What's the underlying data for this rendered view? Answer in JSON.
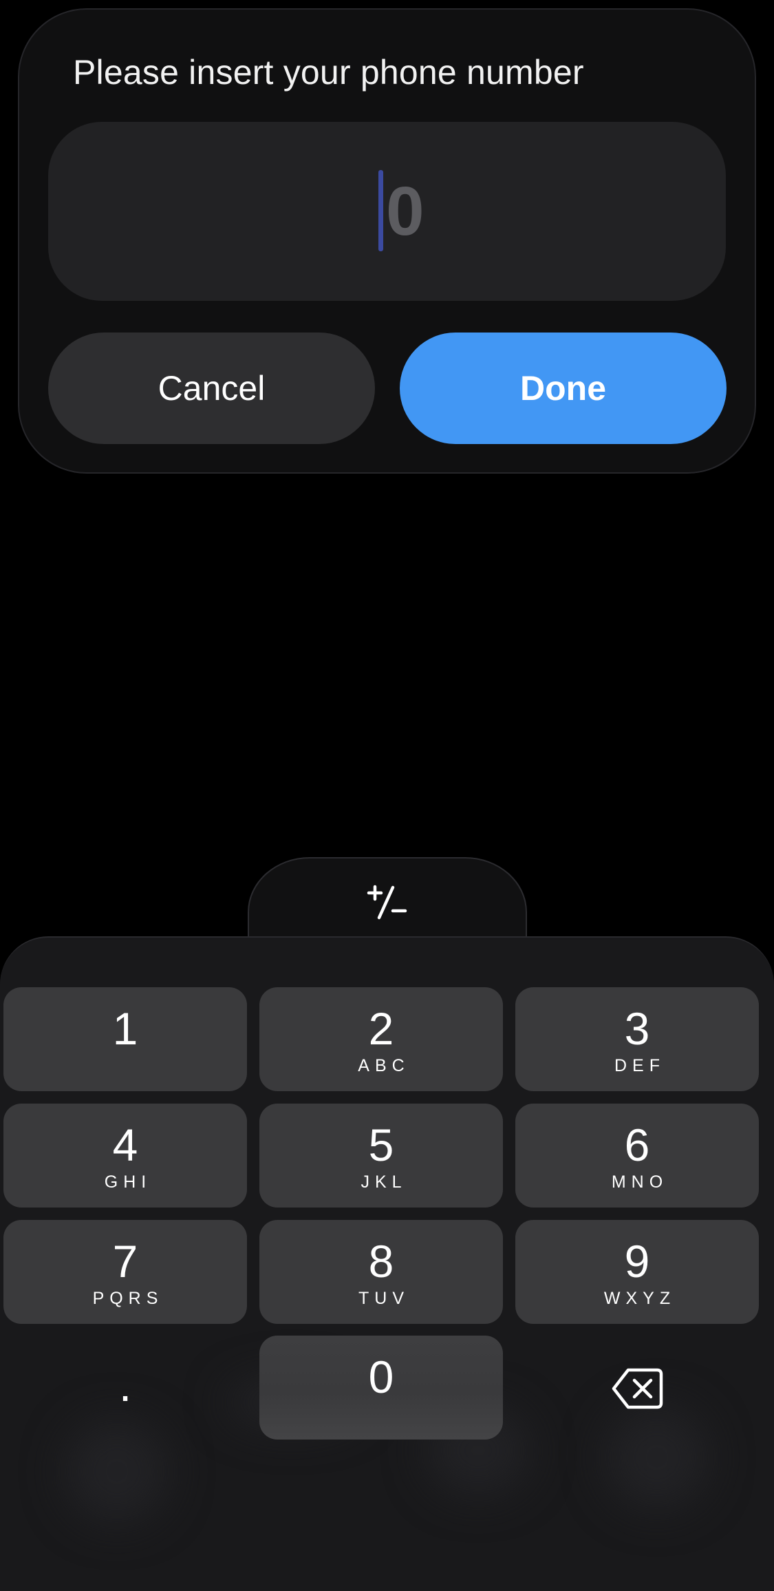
{
  "dialog": {
    "title": "Please insert your phone number",
    "phone_value": "0",
    "cancel_label": "Cancel",
    "done_label": "Done"
  },
  "sign_toggle": {
    "icon": "plus-minus-icon"
  },
  "keypad": {
    "keys": [
      {
        "digit": "1",
        "letters": ""
      },
      {
        "digit": "2",
        "letters": "ABC"
      },
      {
        "digit": "3",
        "letters": "DEF"
      },
      {
        "digit": "4",
        "letters": "GHI"
      },
      {
        "digit": "5",
        "letters": "JKL"
      },
      {
        "digit": "6",
        "letters": "MNO"
      },
      {
        "digit": "7",
        "letters": "PQRS"
      },
      {
        "digit": "8",
        "letters": "TUV"
      },
      {
        "digit": "9",
        "letters": "WXYZ"
      }
    ],
    "decimal_label": ".",
    "zero_label": "0",
    "delete_icon": "backspace-icon"
  },
  "colors": {
    "background": "#000000",
    "dialog": "#101011",
    "field": "#222224",
    "cancel": "#2e2e30",
    "accent": "#4297f4",
    "caret": "#3b4aa0",
    "keypad": "#19191b",
    "key": "#3a3a3c"
  }
}
